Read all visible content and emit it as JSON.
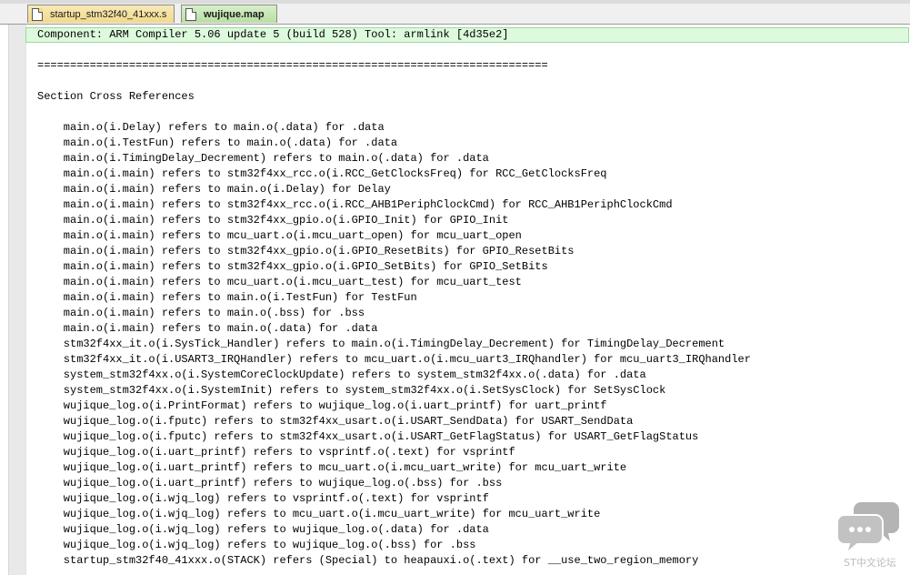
{
  "tabs": [
    {
      "label": "startup_stm32f40_41xxx.s",
      "active": false
    },
    {
      "label": "wujique.map",
      "active": true
    }
  ],
  "editor": {
    "lines": [
      "Component: ARM Compiler 5.06 update 5 (build 528) Tool: armlink [4d35e2]",
      "",
      "==============================================================================",
      "",
      "Section Cross References",
      "",
      "    main.o(i.Delay) refers to main.o(.data) for .data",
      "    main.o(i.TestFun) refers to main.o(.data) for .data",
      "    main.o(i.TimingDelay_Decrement) refers to main.o(.data) for .data",
      "    main.o(i.main) refers to stm32f4xx_rcc.o(i.RCC_GetClocksFreq) for RCC_GetClocksFreq",
      "    main.o(i.main) refers to main.o(i.Delay) for Delay",
      "    main.o(i.main) refers to stm32f4xx_rcc.o(i.RCC_AHB1PeriphClockCmd) for RCC_AHB1PeriphClockCmd",
      "    main.o(i.main) refers to stm32f4xx_gpio.o(i.GPIO_Init) for GPIO_Init",
      "    main.o(i.main) refers to mcu_uart.o(i.mcu_uart_open) for mcu_uart_open",
      "    main.o(i.main) refers to stm32f4xx_gpio.o(i.GPIO_ResetBits) for GPIO_ResetBits",
      "    main.o(i.main) refers to stm32f4xx_gpio.o(i.GPIO_SetBits) for GPIO_SetBits",
      "    main.o(i.main) refers to mcu_uart.o(i.mcu_uart_test) for mcu_uart_test",
      "    main.o(i.main) refers to main.o(i.TestFun) for TestFun",
      "    main.o(i.main) refers to main.o(.bss) for .bss",
      "    main.o(i.main) refers to main.o(.data) for .data",
      "    stm32f4xx_it.o(i.SysTick_Handler) refers to main.o(i.TimingDelay_Decrement) for TimingDelay_Decrement",
      "    stm32f4xx_it.o(i.USART3_IRQHandler) refers to mcu_uart.o(i.mcu_uart3_IRQhandler) for mcu_uart3_IRQhandler",
      "    system_stm32f4xx.o(i.SystemCoreClockUpdate) refers to system_stm32f4xx.o(.data) for .data",
      "    system_stm32f4xx.o(i.SystemInit) refers to system_stm32f4xx.o(i.SetSysClock) for SetSysClock",
      "    wujique_log.o(i.PrintFormat) refers to wujique_log.o(i.uart_printf) for uart_printf",
      "    wujique_log.o(i.fputc) refers to stm32f4xx_usart.o(i.USART_SendData) for USART_SendData",
      "    wujique_log.o(i.fputc) refers to stm32f4xx_usart.o(i.USART_GetFlagStatus) for USART_GetFlagStatus",
      "    wujique_log.o(i.uart_printf) refers to vsprintf.o(.text) for vsprintf",
      "    wujique_log.o(i.uart_printf) refers to mcu_uart.o(i.mcu_uart_write) for mcu_uart_write",
      "    wujique_log.o(i.uart_printf) refers to wujique_log.o(.bss) for .bss",
      "    wujique_log.o(i.wjq_log) refers to vsprintf.o(.text) for vsprintf",
      "    wujique_log.o(i.wjq_log) refers to mcu_uart.o(i.mcu_uart_write) for mcu_uart_write",
      "    wujique_log.o(i.wjq_log) refers to wujique_log.o(.data) for .data",
      "    wujique_log.o(i.wjq_log) refers to wujique_log.o(.bss) for .bss",
      "    startup_stm32f40_41xxx.o(STACK) refers (Special) to heapauxi.o(.text) for __use_two_region_memory"
    ]
  },
  "watermark": {
    "label": "ST中文论坛",
    "icon": "chat-bubbles-icon"
  }
}
